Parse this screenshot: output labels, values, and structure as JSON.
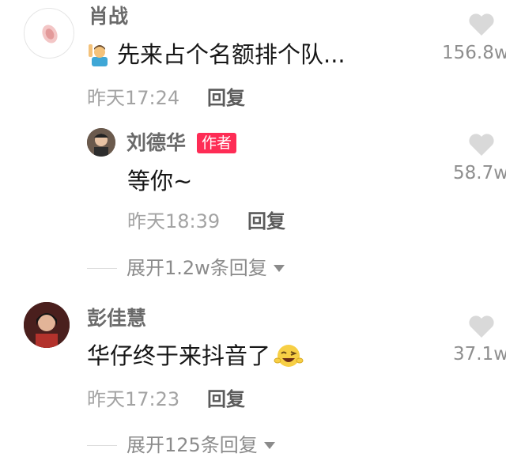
{
  "comments": [
    {
      "author": "肖战",
      "text": "先来占个名额排个队...",
      "emoji_icon": "man-raising-hand-icon",
      "time": "昨天17:24",
      "reply_label": "回复",
      "likes": "156.8w",
      "reply": {
        "author": "刘德华",
        "badge": "作者",
        "text": "等你~",
        "time": "昨天18:39",
        "reply_label": "回复",
        "likes": "58.7w"
      },
      "expand_label": "展开1.2w条回复"
    },
    {
      "author": "彭佳慧",
      "text": "华仔终于来抖音了",
      "emoji_icon": "winking-face-icon",
      "time": "昨天17:23",
      "reply_label": "回复",
      "likes": "37.1w",
      "expand_label": "展开125条回复"
    }
  ],
  "colors": {
    "badge": "#fe2c55",
    "heart": "#d9d9d9",
    "muted_text": "#a3a3a3"
  }
}
